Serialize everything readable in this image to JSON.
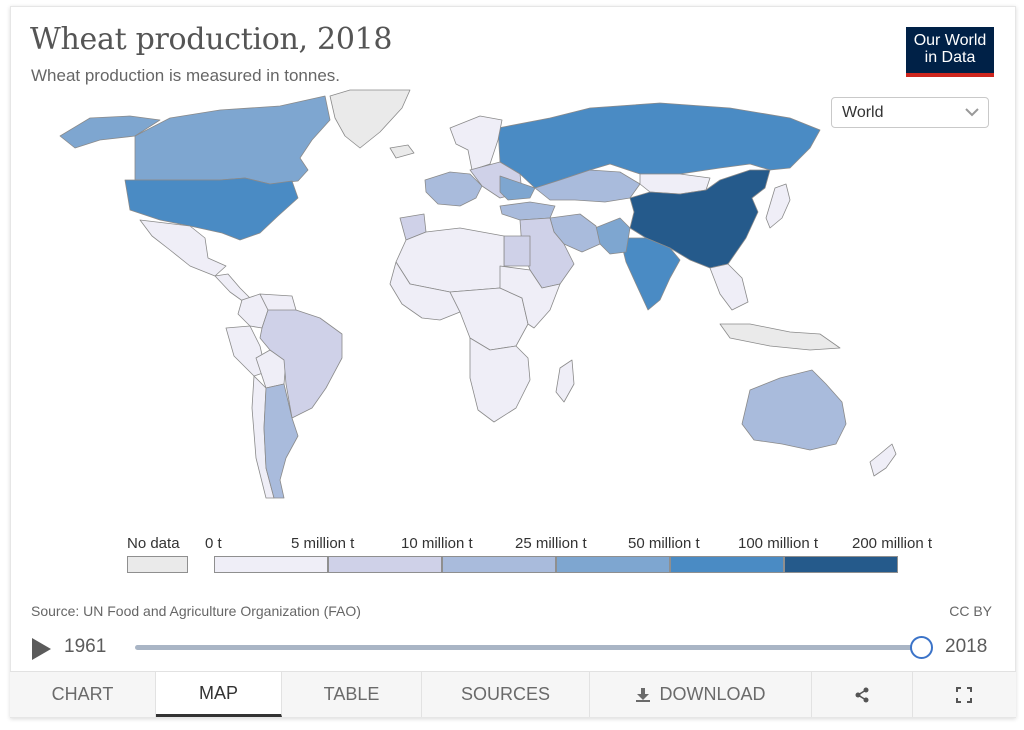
{
  "header": {
    "title": "Wheat production, 2018",
    "subtitle": "Wheat production is measured in tonnes.",
    "logo_line1": "Our World",
    "logo_line2": "in Data"
  },
  "region_selector": {
    "value": "World"
  },
  "colors": {
    "no_data": "#eaeaea",
    "bins": [
      "#efeef7",
      "#cfd1e8",
      "#a9bbdc",
      "#7ea6d0",
      "#4a8bc4",
      "#255a8b"
    ],
    "ocean": "#ffffff",
    "border": "#8a8a8a"
  },
  "legend": {
    "no_data_label": "No data",
    "labels": [
      "0 t",
      "5 million t",
      "10 million t",
      "25 million t",
      "50 million t",
      "100 million t",
      "200 million t"
    ]
  },
  "countries": [
    {
      "name": "Canada",
      "bin": 3
    },
    {
      "name": "United States",
      "bin": 4
    },
    {
      "name": "Mexico",
      "bin": 0
    },
    {
      "name": "Central America",
      "bin": 0
    },
    {
      "name": "Colombia",
      "bin": 0
    },
    {
      "name": "Venezuela",
      "bin": 0
    },
    {
      "name": "Peru",
      "bin": 0
    },
    {
      "name": "Bolivia",
      "bin": 0
    },
    {
      "name": "Brazil",
      "bin": 1
    },
    {
      "name": "Chile",
      "bin": 0
    },
    {
      "name": "Argentina",
      "bin": 2
    },
    {
      "name": "Greenland",
      "bin": -1
    },
    {
      "name": "Iceland",
      "bin": -1
    },
    {
      "name": "Arctic Islands",
      "bin": 3
    },
    {
      "name": "Russia",
      "bin": 4
    },
    {
      "name": "Scandinavia",
      "bin": 0
    },
    {
      "name": "Western Europe",
      "bin": 2
    },
    {
      "name": "Eastern Europe",
      "bin": 1
    },
    {
      "name": "Ukraine",
      "bin": 3
    },
    {
      "name": "Turkey",
      "bin": 2
    },
    {
      "name": "Kazakhstan",
      "bin": 2
    },
    {
      "name": "Mongolia",
      "bin": 0
    },
    {
      "name": "China",
      "bin": 5
    },
    {
      "name": "India",
      "bin": 4
    },
    {
      "name": "Pakistan",
      "bin": 3
    },
    {
      "name": "Iran",
      "bin": 2
    },
    {
      "name": "Middle East",
      "bin": 1
    },
    {
      "name": "Egypt",
      "bin": 1
    },
    {
      "name": "Morocco",
      "bin": 1
    },
    {
      "name": "North Africa",
      "bin": 0
    },
    {
      "name": "West Africa",
      "bin": 0
    },
    {
      "name": "Central Africa",
      "bin": 0
    },
    {
      "name": "East Africa",
      "bin": 0
    },
    {
      "name": "Southern Africa",
      "bin": 0
    },
    {
      "name": "Madagascar",
      "bin": 0
    },
    {
      "name": "Southeast Asia",
      "bin": 0
    },
    {
      "name": "Indonesia",
      "bin": -1
    },
    {
      "name": "Japan",
      "bin": 0
    },
    {
      "name": "Australia",
      "bin": 2
    },
    {
      "name": "New Zealand",
      "bin": 0
    }
  ],
  "footer": {
    "source": "Source: UN Food and Agriculture Organization (FAO)",
    "license": "CC BY"
  },
  "timeline": {
    "start_year": "1961",
    "end_year": "2018",
    "position": 1.0
  },
  "tabs": [
    {
      "label": "CHART",
      "active": false
    },
    {
      "label": "MAP",
      "active": true
    },
    {
      "label": "TABLE",
      "active": false
    },
    {
      "label": "SOURCES",
      "active": false
    },
    {
      "label": "DOWNLOAD",
      "active": false
    }
  ]
}
